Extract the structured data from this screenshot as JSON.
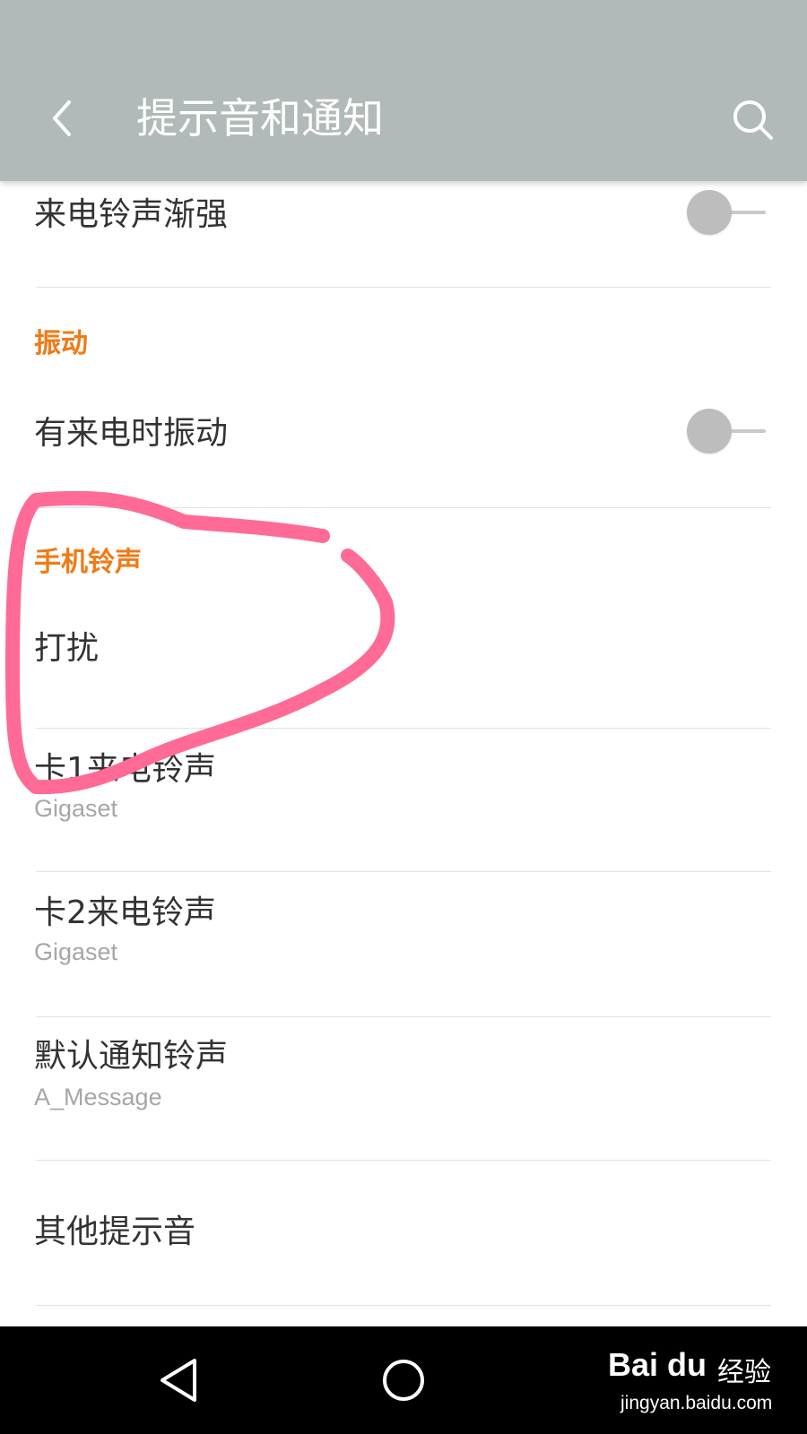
{
  "header": {
    "title": "提示音和通知",
    "back_icon": "back-chevron-icon",
    "search_icon": "search-icon",
    "background": "#b2b9b9"
  },
  "settings": {
    "ringtone_fade_in": {
      "label": "来电铃声渐强",
      "enabled": false
    },
    "vibration_section": {
      "title": "振动"
    },
    "vibrate_on_call": {
      "label": "有来电时振动",
      "enabled": false
    },
    "ringtone_section": {
      "title": "手机铃声"
    },
    "do_not_disturb": {
      "label": "打扰"
    },
    "sim1_ringtone": {
      "label": "卡1来电铃声",
      "value": "Gigaset"
    },
    "sim2_ringtone": {
      "label": "卡2来电铃声",
      "value": "Gigaset"
    },
    "default_notification": {
      "label": "默认通知铃声",
      "value": "A_Message"
    },
    "other_sounds": {
      "label": "其他提示音"
    }
  },
  "colors": {
    "section_accent": "#f07a15",
    "annotation_stroke": "#ff6a96",
    "text_primary": "#333333",
    "text_secondary": "#a6a6a6"
  },
  "navbar": {
    "back_icon": "nav-back-triangle-icon",
    "home_icon": "nav-home-circle-icon"
  },
  "watermark": {
    "logo_text": "Bai du",
    "jingyan": "经验",
    "url": "jingyan.baidu.com"
  }
}
